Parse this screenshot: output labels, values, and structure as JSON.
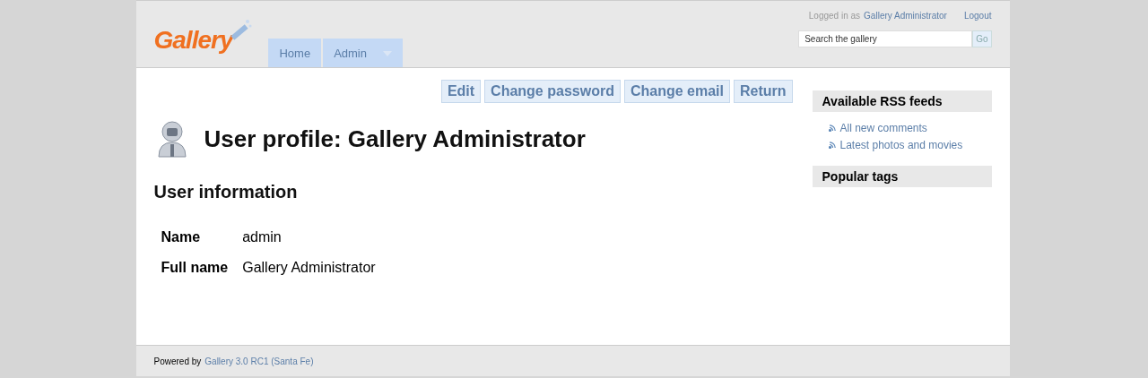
{
  "header": {
    "logo": "Gallery",
    "login_prefix": "Logged in as",
    "user_link": "Gallery Administrator",
    "logout": "Logout",
    "search": {
      "placeholder": "Search the gallery",
      "button": "Go"
    },
    "menu": [
      {
        "label": "Home",
        "has_dropdown": false
      },
      {
        "label": "Admin",
        "has_dropdown": true
      }
    ]
  },
  "actions": [
    "Edit",
    "Change password",
    "Change email",
    "Return"
  ],
  "title": "User profile: Gallery Administrator",
  "section": "User information",
  "fields": [
    {
      "label": "Name",
      "value": "admin"
    },
    {
      "label": "Full name",
      "value": "Gallery Administrator"
    }
  ],
  "sidebar": [
    {
      "title": "Available RSS feeds",
      "links": [
        "All new comments",
        "Latest photos and movies"
      ]
    },
    {
      "title": "Popular tags"
    }
  ],
  "footer": {
    "prefix": "Powered by",
    "link": "Gallery 3.0 RC1 (Santa Fe)"
  }
}
